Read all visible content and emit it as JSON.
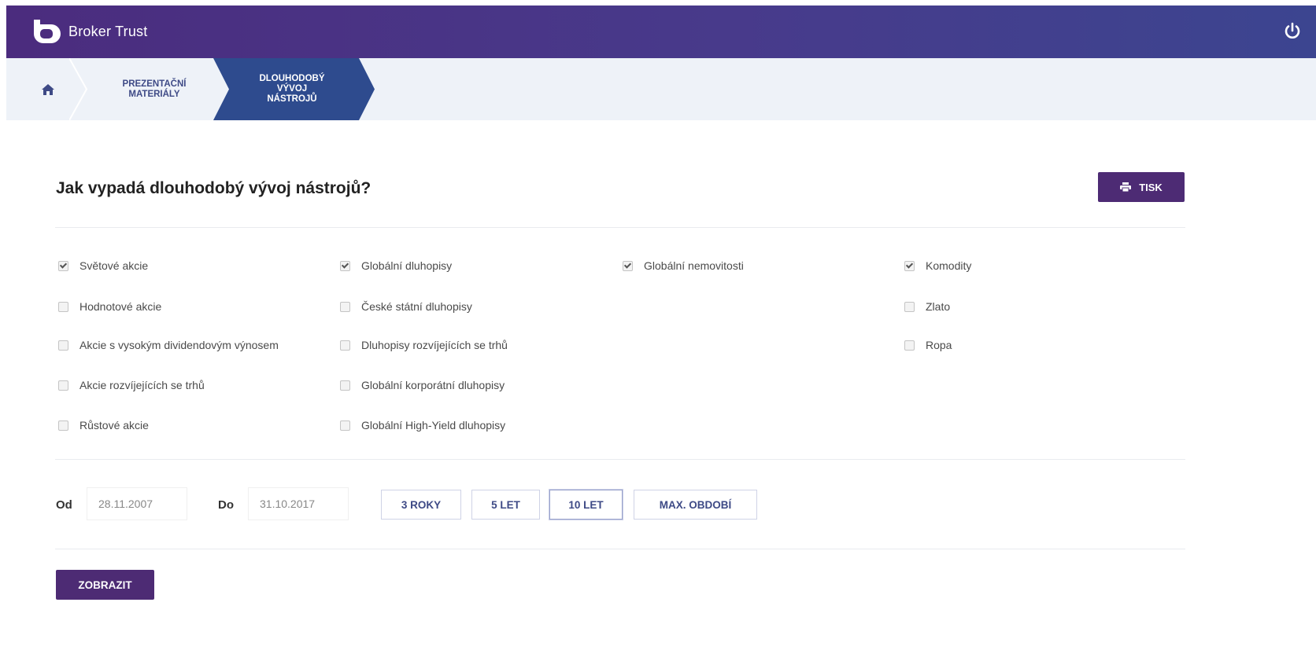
{
  "header": {
    "brand": "Broker Trust",
    "logo_icon": "broker-trust-logo",
    "power_icon": "power-icon"
  },
  "breadcrumb": {
    "home_icon": "home-icon",
    "items": [
      {
        "label_line1": "PREZENTAČNÍ",
        "label_line2": "MATERIÁLY"
      },
      {
        "label_line1": "DLOUHODOBÝ",
        "label_line2": "VÝVOJ",
        "label_line3": "NÁSTROJŮ"
      }
    ]
  },
  "main": {
    "title": "Jak vypadá dlouhodobý vývoj nástrojů?",
    "print_label": "TISK",
    "instruments": {
      "col1": [
        {
          "label": "Světové akcie",
          "checked": true
        },
        {
          "label": "Hodnotové akcie",
          "checked": false
        },
        {
          "label": "Akcie s vysokým dividendovým výnosem",
          "checked": false
        },
        {
          "label": "Akcie rozvíjejících se trhů",
          "checked": false
        },
        {
          "label": "Růstové akcie",
          "checked": false
        }
      ],
      "col2": [
        {
          "label": "Globální dluhopisy",
          "checked": true
        },
        {
          "label": "České státní dluhopisy",
          "checked": false
        },
        {
          "label": "Dluhopisy rozvíjejících se trhů",
          "checked": false
        },
        {
          "label": "Globální korporátní dluhopisy",
          "checked": false
        },
        {
          "label": "Globální High-Yield dluhopisy",
          "checked": false
        }
      ],
      "col3": [
        {
          "label": "Globální nemovitosti",
          "checked": true
        }
      ],
      "col4": [
        {
          "label": "Komodity",
          "checked": true
        },
        {
          "label": "Zlato",
          "checked": false
        },
        {
          "label": "Ropa",
          "checked": false
        }
      ]
    },
    "period": {
      "from_label": "Od",
      "from_value": "28.11.2007",
      "to_label": "Do",
      "to_value": "31.10.2017",
      "buttons": [
        "3 ROKY",
        "5 LET",
        "10 LET",
        "MAX. OBDOBÍ"
      ],
      "active_button": "10 LET"
    },
    "show_label": "ZOBRAZIT"
  },
  "colors": {
    "brand_purple": "#4d2b74",
    "breadcrumb_active": "#2e4b8e",
    "breadcrumb_bg": "#eef2f8"
  }
}
